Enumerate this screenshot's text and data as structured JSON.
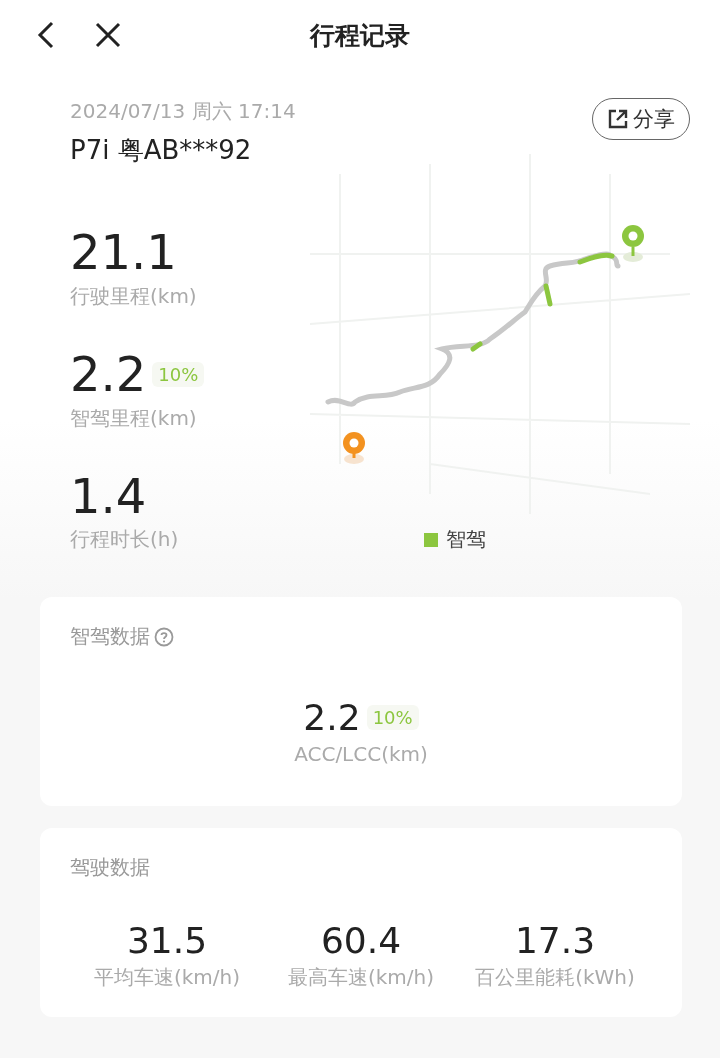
{
  "header": {
    "title": "行程记录"
  },
  "trip": {
    "datetime": "2024/07/13 周六 17:14",
    "vehicle": "P7i 粤AB***92",
    "share": "分享"
  },
  "stats": [
    {
      "value": "21.1",
      "label": "行驶里程(km)"
    },
    {
      "value": "2.2",
      "badge": "10%",
      "label": "智驾里程(km)"
    },
    {
      "value": "1.4",
      "label": "行程时长(h)"
    }
  ],
  "map": {
    "legend": {
      "label": "智驾",
      "color": "#8cc63f"
    }
  },
  "assist_card": {
    "title": "智驾数据",
    "value": "2.2",
    "badge": "10%",
    "label": "ACC/LCC(km)"
  },
  "driving_card": {
    "title": "驾驶数据",
    "items": [
      {
        "value": "31.5",
        "label": "平均车速(km/h)"
      },
      {
        "value": "60.4",
        "label": "最高车速(km/h)"
      },
      {
        "value": "17.3",
        "label": "百公里能耗(kWh)"
      }
    ]
  }
}
